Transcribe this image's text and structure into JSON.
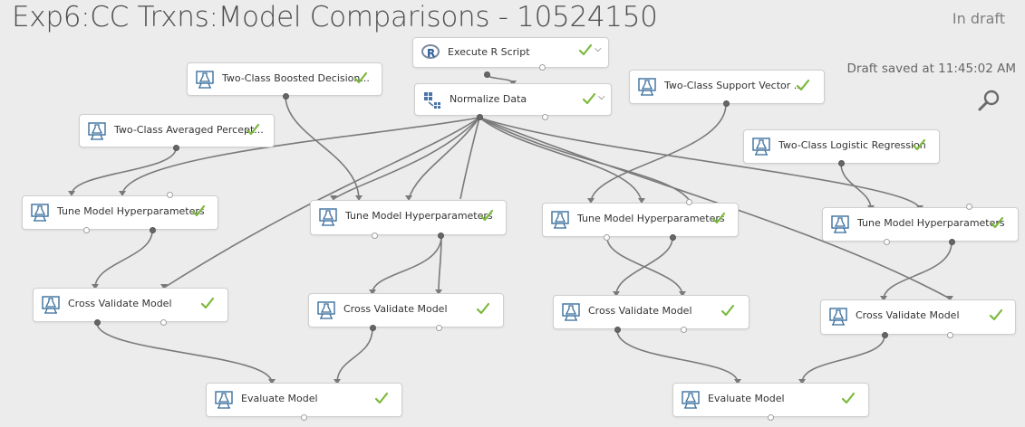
{
  "header": {
    "title": "Exp6:CC Trxns:Model Comparisons - 10524150",
    "status": "In draft",
    "saved_text": "Draft saved at 11:45:02 AM"
  },
  "colors": {
    "background": "#ececec",
    "check": "#7cb93d",
    "edge": "#7a7a7a",
    "title": "#4d4d4d"
  },
  "modules": {
    "execute_r": {
      "label": "Execute R Script",
      "icon": "r-logo-icon"
    },
    "normalize": {
      "label": "Normalize Data",
      "icon": "normalize-data-icon"
    },
    "boosted": {
      "label": "Two-Class Boosted Decision...",
      "icon": "flask-icon"
    },
    "svm": {
      "label": "Two-Class Support Vector ...",
      "icon": "flask-icon"
    },
    "averaged": {
      "label": "Two-Class Averaged Percept...",
      "icon": "flask-icon"
    },
    "logistic": {
      "label": "Two-Class Logistic Regression",
      "icon": "flask-icon"
    },
    "tune1": {
      "label": "Tune Model Hyperparameters",
      "icon": "flask-icon"
    },
    "tune2": {
      "label": "Tune Model Hyperparameters",
      "icon": "flask-icon"
    },
    "tune3": {
      "label": "Tune Model Hyperparameters",
      "icon": "flask-icon"
    },
    "tune4": {
      "label": "Tune Model Hyperparameters",
      "icon": "flask-icon"
    },
    "cv1": {
      "label": "Cross Validate Model",
      "icon": "flask-icon"
    },
    "cv2": {
      "label": "Cross Validate Model",
      "icon": "flask-icon"
    },
    "cv3": {
      "label": "Cross Validate Model",
      "icon": "flask-icon"
    },
    "cv4": {
      "label": "Cross Validate Model",
      "icon": "flask-icon"
    },
    "eval1": {
      "label": "Evaluate Model",
      "icon": "flask-icon"
    },
    "eval2": {
      "label": "Evaluate Model",
      "icon": "flask-icon"
    }
  }
}
